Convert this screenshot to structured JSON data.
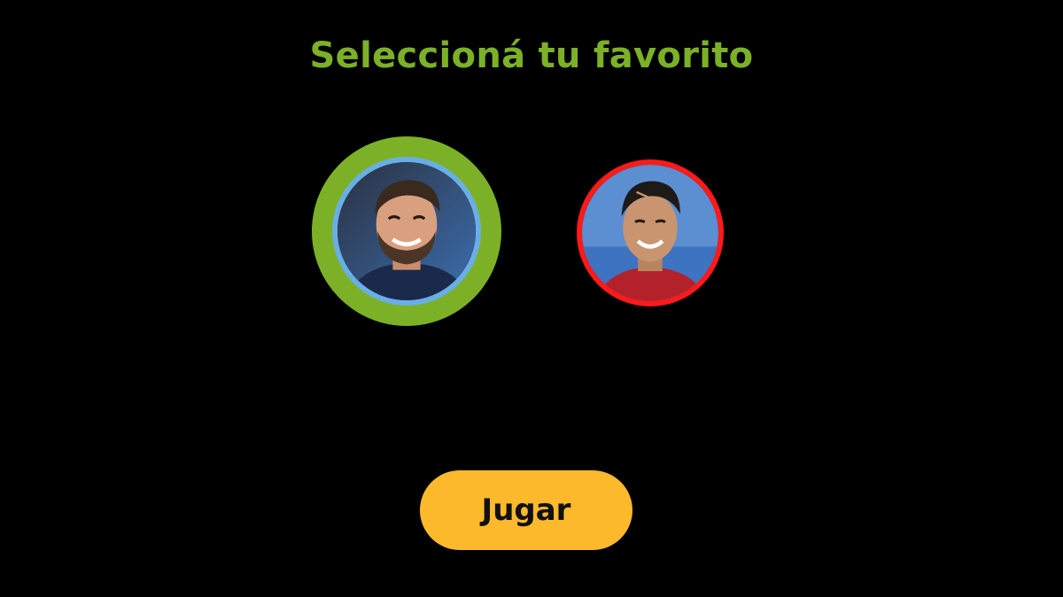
{
  "title": "Seleccioná tu favorito",
  "players": [
    {
      "id": "messi",
      "selected": true,
      "ring_color": "#7cb127",
      "inner_border_color": "#6aaee6"
    },
    {
      "id": "ronaldo",
      "selected": false,
      "border_color": "#ff1a1a"
    }
  ],
  "play_button": {
    "label": "Jugar",
    "color": "#fdb92c"
  },
  "colors": {
    "background": "#000000",
    "title": "#7cb127"
  }
}
